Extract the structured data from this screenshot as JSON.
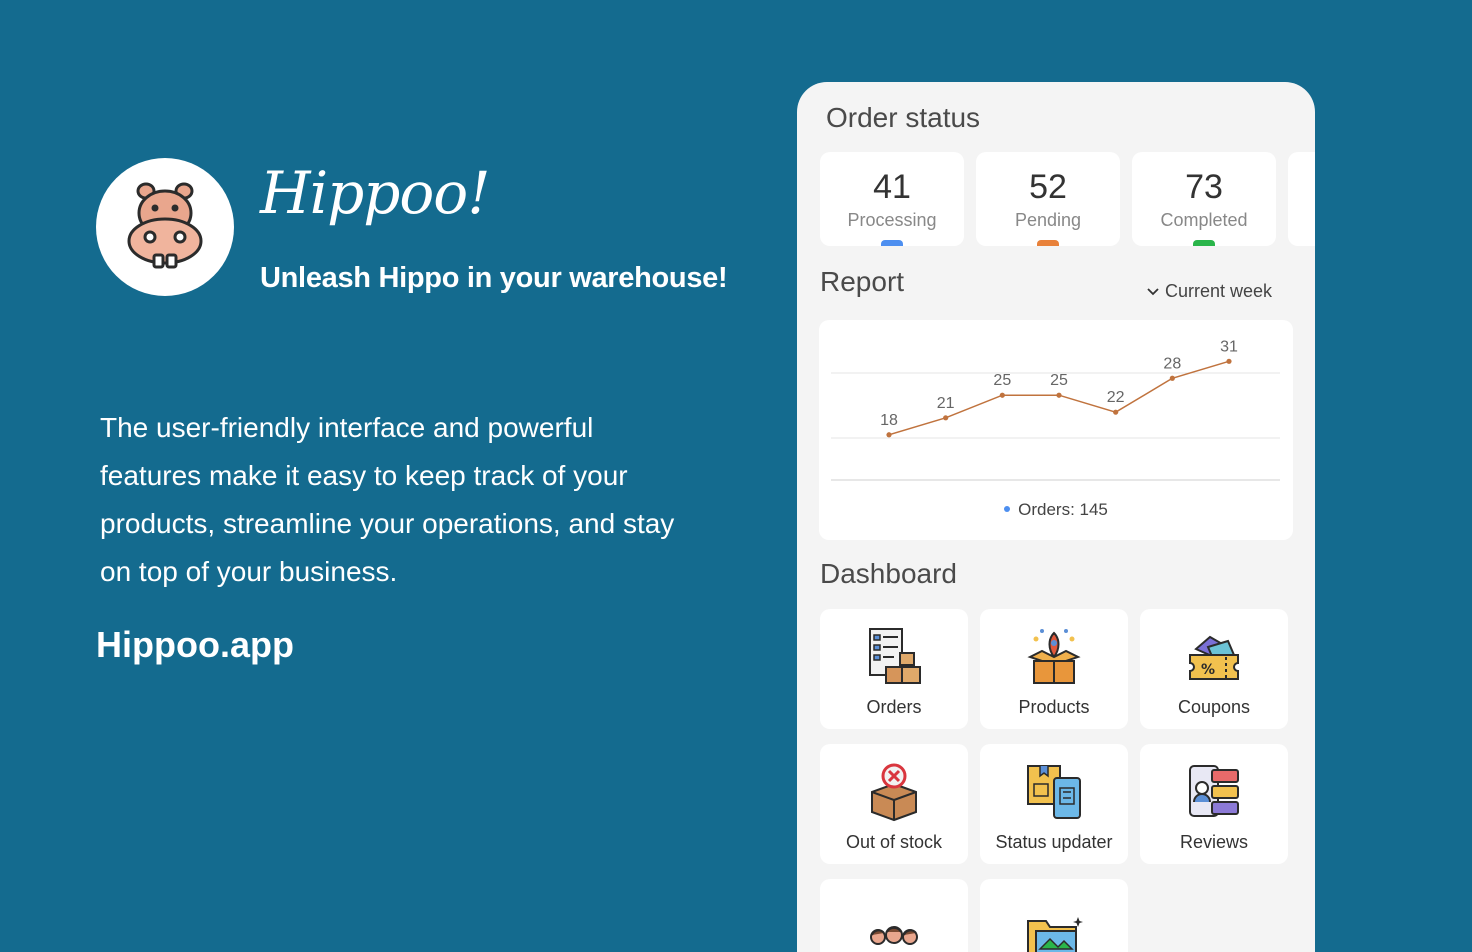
{
  "brand": {
    "name": "Hippoo!",
    "tagline": "Unleash Hippo in your warehouse!",
    "description": "The user-friendly interface and powerful features make it easy to keep track of your products, streamline your operations, and stay on top of your business.",
    "site": "Hippoo.app",
    "logo_icon": "hippo-icon"
  },
  "order_status": {
    "title": "Order status",
    "cards": [
      {
        "value": "41",
        "label": "Processing",
        "color": "#4d8ff0"
      },
      {
        "value": "52",
        "label": "Pending",
        "color": "#e8813a"
      },
      {
        "value": "73",
        "label": "Completed",
        "color": "#2ab54a"
      }
    ]
  },
  "report": {
    "title": "Report",
    "period": "Current week",
    "legend": "Orders: 145",
    "legend_color": "#4d8ff0",
    "line_color": "#c0733e"
  },
  "chart_data": {
    "type": "line",
    "title": "",
    "x": [
      1,
      2,
      3,
      4,
      5,
      6,
      7
    ],
    "series": [
      {
        "name": "Orders",
        "values": [
          18,
          21,
          25,
          25,
          22,
          28,
          31
        ]
      }
    ],
    "xlabel": "",
    "ylabel": "",
    "ylim": [
      10,
      33
    ],
    "grid": true
  },
  "dashboard": {
    "title": "Dashboard",
    "items": [
      {
        "label": "Orders",
        "icon": "orders-icon"
      },
      {
        "label": "Products",
        "icon": "products-icon"
      },
      {
        "label": "Coupons",
        "icon": "coupons-icon"
      },
      {
        "label": "Out of stock",
        "icon": "out-of-stock-icon"
      },
      {
        "label": "Status updater",
        "icon": "status-updater-icon"
      },
      {
        "label": "Reviews",
        "icon": "reviews-icon"
      },
      {
        "label": "",
        "icon": "customers-icon"
      },
      {
        "label": "",
        "icon": "media-icon"
      }
    ]
  }
}
